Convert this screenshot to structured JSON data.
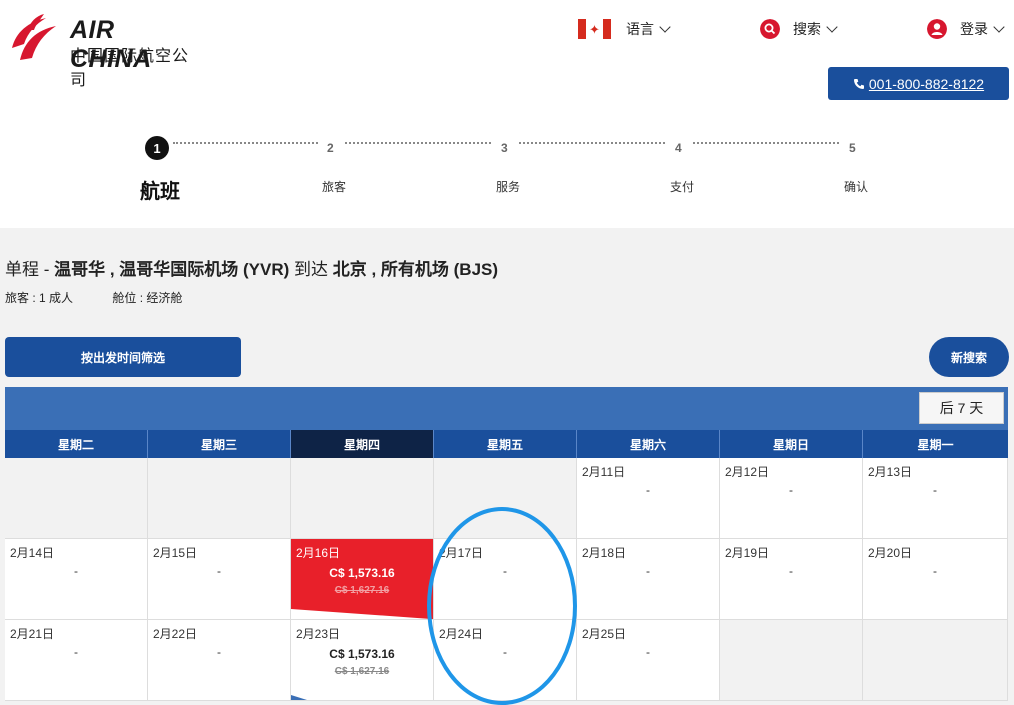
{
  "brand": {
    "name_en": "AIR CHINA",
    "name_cn": "中国国际航空公司"
  },
  "topnav": {
    "language": "语言",
    "search": "搜索",
    "login": "登录"
  },
  "phone": "001-800-882-8122",
  "steps": [
    {
      "num": "1",
      "label": "航班"
    },
    {
      "num": "2",
      "label": "旅客"
    },
    {
      "num": "3",
      "label": "服务"
    },
    {
      "num": "4",
      "label": "支付"
    },
    {
      "num": "5",
      "label": "确认"
    }
  ],
  "trip": {
    "type": "单程",
    "sep": " - ",
    "origin": "温哥华 , 温哥华国际机场 (YVR)",
    "to": " 到达 ",
    "destination": "北京 , 所有机场 (BJS)",
    "passengers": "旅客 : 1 成人",
    "cabin": "舱位 : 经济舱"
  },
  "buttons": {
    "filter": "按出发时间筛选",
    "new_search": "新搜索",
    "next7": "后 7 天"
  },
  "weekdays": [
    "星期二",
    "星期三",
    "星期四",
    "星期五",
    "星期六",
    "星期日",
    "星期一"
  ],
  "rows": [
    [
      {
        "date": "",
        "value": ""
      },
      {
        "date": "",
        "value": ""
      },
      {
        "date": "",
        "value": ""
      },
      {
        "date": "",
        "value": ""
      },
      {
        "date": "2月11日",
        "value": "-"
      },
      {
        "date": "2月12日",
        "value": "-"
      },
      {
        "date": "2月13日",
        "value": "-"
      }
    ],
    [
      {
        "date": "2月14日",
        "value": "-"
      },
      {
        "date": "2月15日",
        "value": "-"
      },
      {
        "date": "2月16日",
        "price": "C$ 1,573.16",
        "old": "C$ 1,627.16"
      },
      {
        "date": "2月17日",
        "value": "-"
      },
      {
        "date": "2月18日",
        "value": "-"
      },
      {
        "date": "2月19日",
        "value": "-"
      },
      {
        "date": "2月20日",
        "value": "-"
      }
    ],
    [
      {
        "date": "2月21日",
        "value": "-"
      },
      {
        "date": "2月22日",
        "value": "-"
      },
      {
        "date": "2月23日",
        "price": "C$ 1,573.16",
        "old": "C$ 1,627.16"
      },
      {
        "date": "2月24日",
        "value": "-"
      },
      {
        "date": "2月25日",
        "value": "-"
      },
      {
        "date": "",
        "value": ""
      },
      {
        "date": "",
        "value": ""
      }
    ]
  ],
  "colors": {
    "brand_blue": "#1a4f9c",
    "bar_blue": "#3a6fb6",
    "selected_day": "#0e2346",
    "highlight_red": "#e8202a",
    "logo_red": "#d7172f",
    "annotation": "#1f96e8"
  }
}
